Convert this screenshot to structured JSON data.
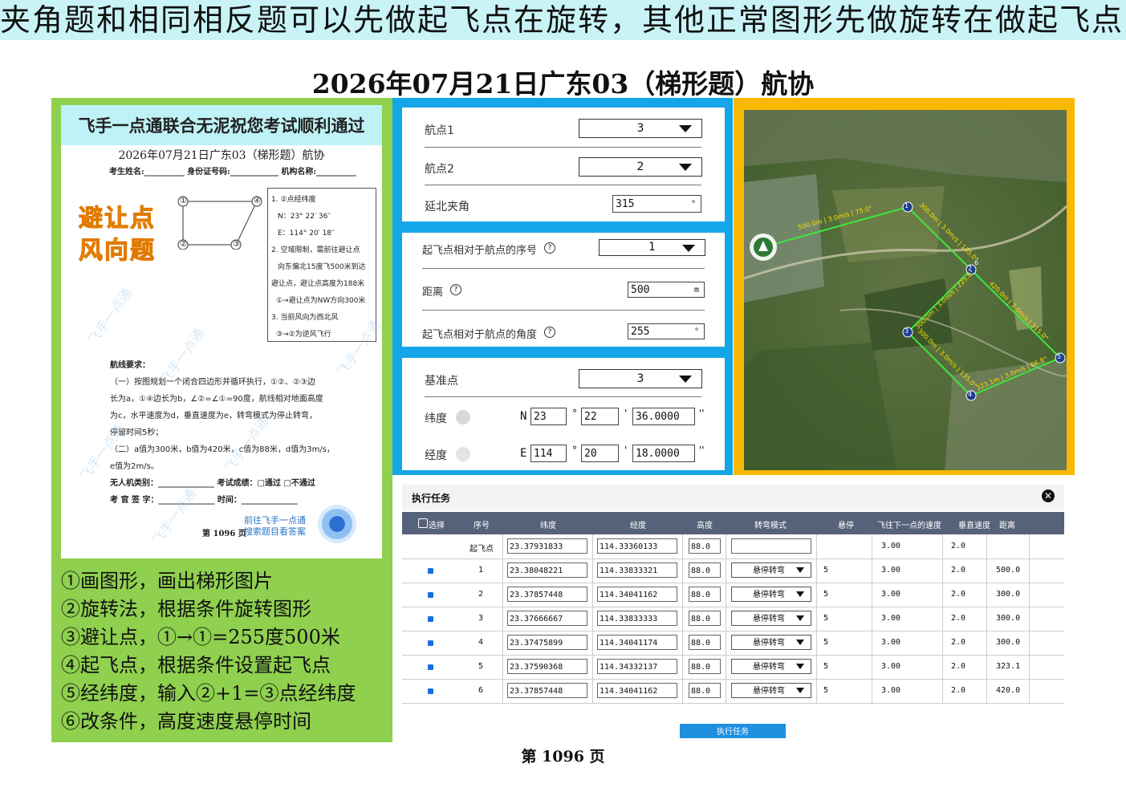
{
  "banner": "夹角题和相同相反题可以先做起飞点在旋转，其他正常图形先做旋转在做起飞点",
  "main_title": "2026年07月21日广东03（梯形题）航协",
  "doc": {
    "header": "飞手一点通联合无泥祝您考试顺利通过",
    "title": "2026年07月21日广东03（梯形题）航协",
    "sig_line": "考生姓名:__________ 身份证号码:____________ 机构名称:__________",
    "stamp1": "避让点",
    "stamp2": "风向题",
    "points": [
      "①",
      "②",
      "③",
      "④"
    ],
    "conditions": [
      "1. ②点经纬度",
      "N：23° 22′ 36″",
      "E：114° 20′ 18″",
      "2. 空域限制，需前往避让点",
      "向东偏北15度飞500米到达",
      "避让点，避让点高度为188米",
      "①→避让点为NW方向300米",
      "3. 当前风向为西北风",
      "③→②为逆风飞行"
    ],
    "req_title": "航线要求：",
    "requirements": [
      "（一）按图规划一个闭合四边形并循环执行，①②、②③边",
      "长为a，①④边长为b，∠②=∠①=90度，航线相对地面高度",
      "为c，水平速度为d，垂直速度为e，转弯模式为停止转弯，",
      "停留时间5秒；",
      "（二）a值为300米，b值为420米，c值为88米，d值为3m/s，",
      "e值为2m/s。"
    ],
    "type_line": "无人机类别：______________  考试成绩：□通过  □不通过",
    "examiner_line": "考 官 签 字：______________  时间：______________",
    "qr_hint1": "前往飞手一点通",
    "qr_hint2": "搜索题目看答案",
    "page_num": "第 1096 页",
    "watermark": "飞手一点通"
  },
  "steps": [
    "①画图形，画出梯形图片",
    "②旋转法，根据条件旋转图形",
    "③避让点，①→①=255度500米",
    "④起飞点，根据条件设置起飞点",
    "⑤经纬度，输入②+1=③点经纬度",
    "⑥改条件，高度速度悬停时间"
  ],
  "rotation_form": {
    "wp1_label": "航点1",
    "wp1_value": "3",
    "wp2_label": "航点2",
    "wp2_value": "2",
    "angle_label": "延北夹角",
    "angle_value": "315",
    "angle_unit": "°"
  },
  "takeoff_form": {
    "index_label": "起飞点相对于航点的序号",
    "index_value": "1",
    "dist_label": "距离",
    "dist_value": "500",
    "dist_unit": "m",
    "angle_label": "起飞点相对于航点的角度",
    "angle_value": "255",
    "angle_unit": "°",
    "help": "?"
  },
  "base_form": {
    "base_label": "基准点",
    "base_value": "3",
    "lat_label": "纬度",
    "lat_prefix": "N",
    "lat_deg": "23",
    "lat_min": "22",
    "lat_sec": "36.0000",
    "lon_label": "经度",
    "lon_prefix": "E",
    "lon_deg": "114",
    "lon_min": "20",
    "lon_sec": "18.0000",
    "deg_mark": "°",
    "min_mark": "'",
    "sec_mark": "''"
  },
  "map": {
    "labels": [
      "1",
      "2",
      "3",
      "4",
      "5",
      "6"
    ],
    "segments": [
      "500.0m | 3.0m/s | 75.0°",
      "300.0m | 3.0m/s | 135.0°",
      "300.0m | 3.0m/s | 225.0°",
      "300.0m | 3.0m/s | 135.0°",
      "323.1m | 3.0m/s | 66.8°",
      "420.0m | 3.0m/s | 315.0°"
    ]
  },
  "task": {
    "title": "执行任务",
    "close": "✕",
    "headers": [
      "选择",
      "序号",
      "纬度",
      "经度",
      "高度",
      "转弯模式",
      "悬停",
      "飞往下一点的速度",
      "垂直速度",
      "距离"
    ],
    "rows": [
      {
        "idx": "起飞点",
        "lat": "23.37931833",
        "lon": "114.33360133",
        "alt": "88.0",
        "mode": "",
        "hover": "",
        "speed": "3.00",
        "vspeed": "2.0",
        "dist": ""
      },
      {
        "idx": "1",
        "lat": "23.38048221",
        "lon": "114.33833321",
        "alt": "88.0",
        "mode": "悬停转弯",
        "hover": "5",
        "speed": "3.00",
        "vspeed": "2.0",
        "dist": "500.0"
      },
      {
        "idx": "2",
        "lat": "23.37857448",
        "lon": "114.34041162",
        "alt": "88.0",
        "mode": "悬停转弯",
        "hover": "5",
        "speed": "3.00",
        "vspeed": "2.0",
        "dist": "300.0"
      },
      {
        "idx": "3",
        "lat": "23.37666667",
        "lon": "114.33833333",
        "alt": "88.0",
        "mode": "悬停转弯",
        "hover": "5",
        "speed": "3.00",
        "vspeed": "2.0",
        "dist": "300.0"
      },
      {
        "idx": "4",
        "lat": "23.37475899",
        "lon": "114.34041174",
        "alt": "88.0",
        "mode": "悬停转弯",
        "hover": "5",
        "speed": "3.00",
        "vspeed": "2.0",
        "dist": "300.0"
      },
      {
        "idx": "5",
        "lat": "23.37590368",
        "lon": "114.34332137",
        "alt": "88.0",
        "mode": "悬停转弯",
        "hover": "5",
        "speed": "3.00",
        "vspeed": "2.0",
        "dist": "323.1"
      },
      {
        "idx": "6",
        "lat": "23.37857448",
        "lon": "114.34041162",
        "alt": "88.0",
        "mode": "悬停转弯",
        "hover": "5",
        "speed": "3.00",
        "vspeed": "2.0",
        "dist": "420.0"
      }
    ],
    "run_label": "执行任务"
  },
  "footer": "第 1096 页",
  "colors": {
    "green_panel": "#8fd04f",
    "blue_panel": "#14a6e6",
    "map_frame": "#f9b800",
    "route": "#3ee63e",
    "table_header": "#56627a"
  }
}
